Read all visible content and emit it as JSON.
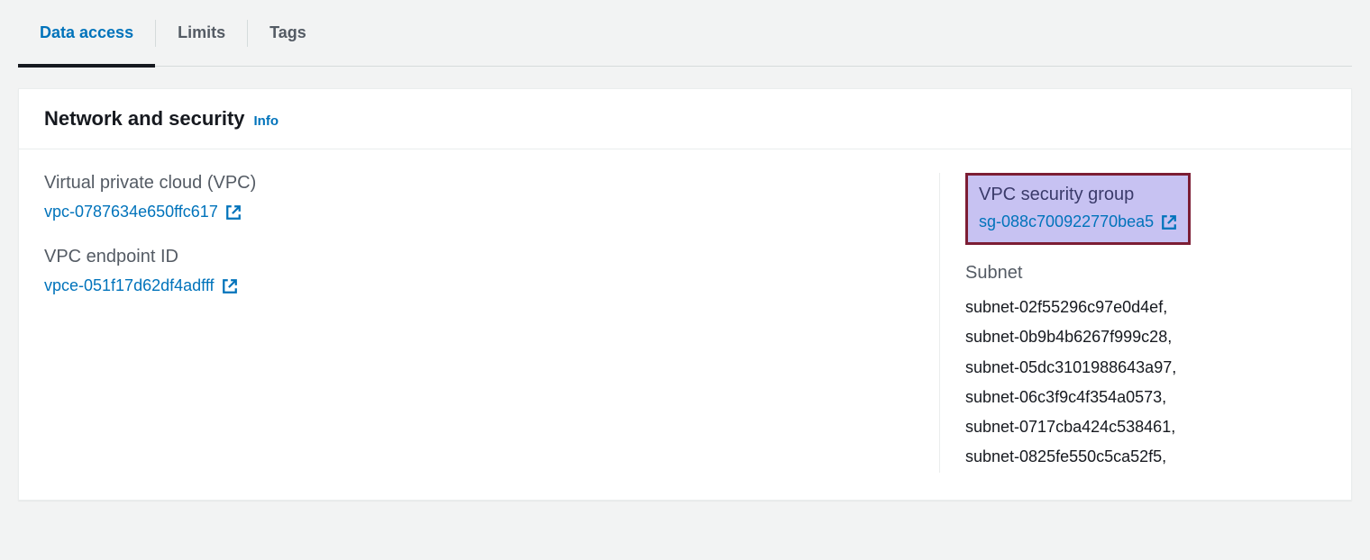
{
  "tabs": {
    "data_access": "Data access",
    "limits": "Limits",
    "tags": "Tags"
  },
  "panel": {
    "title": "Network and security",
    "info": "Info"
  },
  "fields": {
    "vpc": {
      "label": "Virtual private cloud (VPC)",
      "value": "vpc-0787634e650ffc617"
    },
    "vpc_endpoint": {
      "label": "VPC endpoint ID",
      "value": "vpce-051f17d62df4adfff"
    },
    "security_group": {
      "label": "VPC security group",
      "value": "sg-088c700922770bea5"
    },
    "subnet": {
      "label": "Subnet",
      "items": [
        "subnet-02f55296c97e0d4ef,",
        "subnet-0b9b4b6267f999c28,",
        "subnet-05dc3101988643a97,",
        "subnet-06c3f9c4f354a0573,",
        "subnet-0717cba424c538461,",
        "subnet-0825fe550c5ca52f5,"
      ]
    }
  }
}
